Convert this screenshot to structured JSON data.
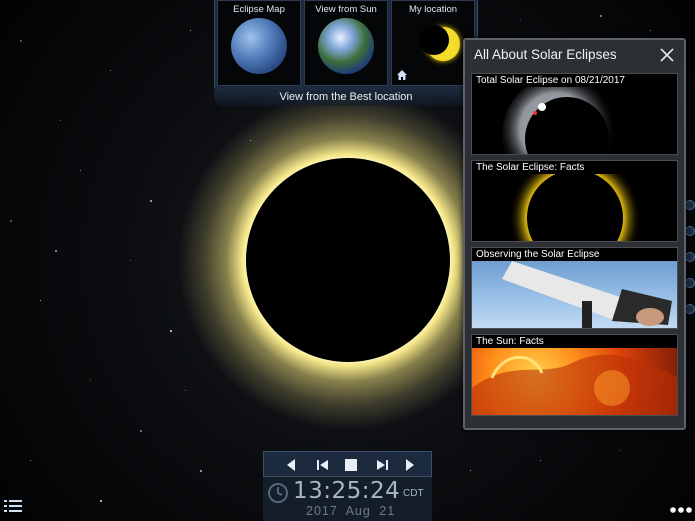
{
  "views": [
    {
      "label": "Eclipse Map"
    },
    {
      "label": "View from Sun"
    },
    {
      "label": "My location"
    }
  ],
  "best_location_label": "View from the Best location",
  "panel": {
    "title": "All About Solar Eclipses",
    "cards": [
      {
        "label": "Total Solar Eclipse on 08/21/2017"
      },
      {
        "label": "The Solar Eclipse: Facts"
      },
      {
        "label": "Observing the Solar Eclipse"
      },
      {
        "label": "The Sun: Facts"
      }
    ]
  },
  "clock": {
    "time": "13:25:24",
    "timezone": "CDT",
    "date": "2017 Aug 21"
  },
  "icons": {
    "close": "close-icon",
    "home": "home-icon",
    "clock": "clock-icon",
    "menu": "list-menu-icon",
    "more": "more-dots-icon",
    "play_back": "play-backward-icon",
    "step_back": "step-backward-icon",
    "stop": "stop-icon",
    "step_forward": "step-forward-icon",
    "play_forward": "play-forward-icon"
  },
  "colors": {
    "accent_bar": "#1e2d42",
    "corona": "#fff3a8",
    "panel_bg": "#2c2f33"
  }
}
